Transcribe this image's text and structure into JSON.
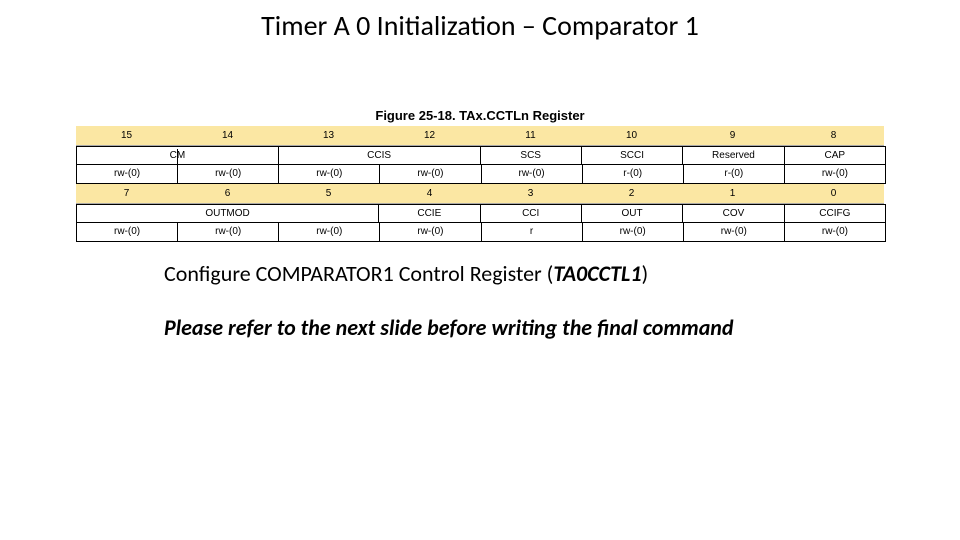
{
  "title": "Timer A 0 Initialization – Comparator 1",
  "figure_caption": "Figure 25-18. TAx.CCTLn Register",
  "register": {
    "high": {
      "bits": [
        "15",
        "14",
        "13",
        "12",
        "11",
        "10",
        "9",
        "8"
      ],
      "fields": [
        {
          "label": "CM",
          "span": 2,
          "split": true
        },
        {
          "label": "CCIS",
          "span": 2
        },
        {
          "label": "SCS",
          "span": 1
        },
        {
          "label": "SCCI",
          "span": 1
        },
        {
          "label": "Reserved",
          "span": 1
        },
        {
          "label": "CAP",
          "span": 1
        }
      ],
      "rw": [
        "rw-(0)",
        "rw-(0)",
        "rw-(0)",
        "rw-(0)",
        "rw-(0)",
        "r-(0)",
        "r-(0)",
        "rw-(0)"
      ]
    },
    "low": {
      "bits": [
        "7",
        "6",
        "5",
        "4",
        "3",
        "2",
        "1",
        "0"
      ],
      "fields": [
        {
          "label": "OUTMOD",
          "span": 3
        },
        {
          "label": "CCIE",
          "span": 1
        },
        {
          "label": "CCI",
          "span": 1
        },
        {
          "label": "OUT",
          "span": 1
        },
        {
          "label": "COV",
          "span": 1
        },
        {
          "label": "CCIFG",
          "span": 1
        }
      ],
      "rw": [
        "rw-(0)",
        "rw-(0)",
        "rw-(0)",
        "rw-(0)",
        "r",
        "rw-(0)",
        "rw-(0)",
        "rw-(0)"
      ]
    }
  },
  "body": {
    "line1_prefix": "Configure  COMPARATOR1 Control Register (",
    "line1_reg": "TA0CCTL1",
    "line1_suffix": ")",
    "line2": "Please refer to the next slide before writing the final command"
  }
}
